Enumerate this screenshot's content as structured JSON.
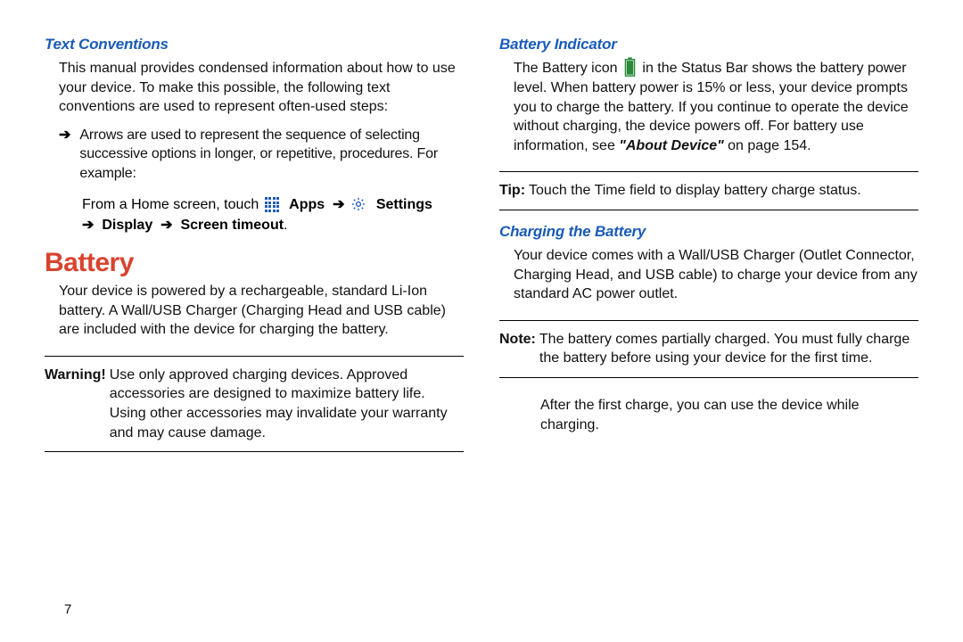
{
  "left": {
    "h_textconv": "Text Conventions",
    "p_textconv": "This manual provides condensed information about how to use your device. To make this possible, the following text conventions are used to represent often-used steps:",
    "bullet1": "Arrows are used to represent the sequence of selecting successive options in longer, or repetitive, procedures. For example:",
    "nav_prefix": "From a Home screen, touch ",
    "nav_apps": "Apps",
    "nav_settings": "Settings",
    "nav_display": "Display",
    "nav_timeout": "Screen timeout",
    "h_battery": "Battery",
    "p_battery": "Your device is powered by a rechargeable, standard Li-Ion battery. A Wall/USB Charger (Charging Head and USB cable) are included with the device for charging the battery.",
    "warn_label": "Warning!",
    "warn_body": "Use only approved charging devices. Approved accessories are designed to maximize battery life. Using other accessories may invalidate your warranty and may cause damage."
  },
  "right": {
    "h_indicator": "Battery Indicator",
    "p_indicator_1": "The Battery icon ",
    "p_indicator_2": " in the Status Bar shows the battery power level. When battery power is 15% or less, your device prompts you to charge the battery. If you continue to operate the device without charging, the device powers off. For battery use information, see ",
    "p_indicator_ref": "\"About Device\"",
    "p_indicator_3": " on page 154.",
    "tip_label": "Tip:",
    "tip_body": "Touch the Time field to display battery charge status.",
    "h_charging": "Charging the Battery",
    "p_charging": "Your device comes with a Wall/USB Charger (Outlet Connector, Charging Head, and USB cable) to charge your device from any standard AC power outlet.",
    "note_label": "Note:",
    "note_body": "The battery comes partially charged. You must fully charge the battery before using your device for the first time.",
    "after_charge": "After the first charge, you can use the device while charging."
  },
  "page_number": "7",
  "icons": {
    "apps": "apps-icon",
    "settings": "settings-icon",
    "battery": "battery-icon",
    "arrow": "➔"
  }
}
